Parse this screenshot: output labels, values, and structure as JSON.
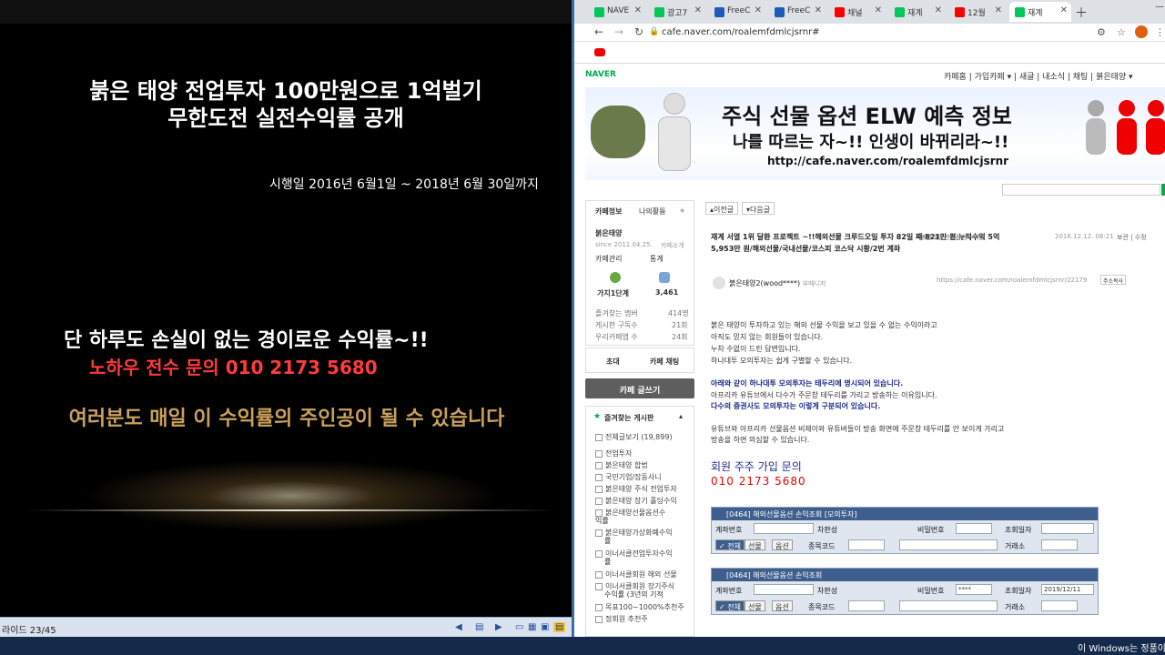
{
  "slide": {
    "title_line1": "붉은 태양 전업투자  100만원으로 1억벌기",
    "title_line2": "무한도전 실전수익률  공개",
    "date_line": "시행일 2016년 6월1일 ~ 2018년 6월 30일까지",
    "line1": "단 하루도 손실이 없는 경이로운 수익률~!!",
    "line2": "노하우 전수 문의 010 2173 5680",
    "line3": "여러분도 매일 이 수익률의 주인공이 될 수 있습니다"
  },
  "slidebar": {
    "label": "라이드 23/45"
  },
  "taskbar": {
    "windows_note": "이 Windows는 정품이 아닙니다"
  },
  "browser": {
    "tabs": [
      {
        "label": "NAVE",
        "icon_color": "#03c75a"
      },
      {
        "label": "광고7",
        "icon_color": "#03c75a"
      },
      {
        "label": "FreeC",
        "icon_color": "#1e5bb8"
      },
      {
        "label": "FreeC",
        "icon_color": "#1e5bb8"
      },
      {
        "label": "채널",
        "icon_color": "#ff0000"
      },
      {
        "label": "재계",
        "icon_color": "#03c75a"
      },
      {
        "label": "12월",
        "icon_color": "#ff0000"
      },
      {
        "label": "재계",
        "icon_color": "#03c75a"
      }
    ],
    "url": "cafe.naver.com/roalemfdmlcjsrnr#"
  },
  "cafe": {
    "logo": "NAVER",
    "menu": "카페홈  |  가입카페 ▾  |  새글  |  내소식  |  채팅  |  붉은태양 ▾",
    "banner_line1": "주식 선물 옵션 ELW 예측 정보",
    "banner_line2": "나를 따르는 자~!! 인생이 바뀌리라~!!",
    "banner_line3": "http://cafe.naver.com/roalemfdmlcjsrnr",
    "side": {
      "tab_info": "카페정보",
      "tab_activity": "나의활동",
      "cafe_name": "붉은태양",
      "since": "since 2011.04.25.",
      "invite": "카페소개",
      "manage": "카페관리",
      "stats": "통계",
      "level": "가지1단계",
      "members": "3,461",
      "fav_members_label": "즐겨찾는 멤버",
      "fav_members_value": "414명",
      "subscribers_label": "게시판 구독수",
      "subscribers_value": "21회",
      "cafe_apps_label": "우리카페앱 수",
      "cafe_apps_value": "24회",
      "invite_btn": "초대",
      "chat_btn": "카페 채팅",
      "write_btn": "카페 글쓰기",
      "fav_board_title": "즐겨찾는 게시판",
      "all_posts": "전체글보기 (19,899)",
      "boards": [
        "전업투자",
        "붉은태양 합법",
        "국민기업/잡동사니",
        "붉은태양 주식 전업투자",
        "붉은태양 장기 홀딩수익",
        "붉은태양선물옵션수",
        "익률",
        "붉은태양가상화폐수익",
        "률",
        "이너서클전업투자수익",
        "률",
        "이너서클회원 해외 선물",
        "이너서클회원 장기주식",
        "수익률 (3년의 기적",
        "목표100~1000%추천주",
        "정회원 추천주"
      ]
    },
    "article": {
      "prev_btn": "▴이전글",
      "next_btn": "▾다음글",
      "title": "재계 서열 1위 달환 프로젝트 ~!!해외선물 크루드오일  투자 82일 째 821만 원 누적수익 5억 5,953만 원/해외선물/국내선물/코스피 코스닥 시황/2번 계좌",
      "board": "붉은태양선물옵션수익률",
      "date": "2016.12.12. 06:21",
      "date_actions": "보관  |  수정",
      "author": "붉은태양2(wood****)",
      "author_tag": "부매니저",
      "permalink": "https://cafe.naver.com/roalemfdmlcjsrnr/22179",
      "copy_btn": "주소복사",
      "paras": [
        "붉은 태양이 투자하고 있는 해외 선물 수익을 보고 있을 수 없는 수익이라고",
        "아직도 믿지 않는 회원들이 있습니다.",
        "누차 수없이 드린 답변입니다.",
        "하나대투 모의투자는 쉽게 구별할 수 있습니다."
      ],
      "blue1": "아래와 같이 하나대투 모의투자는 테두리에 명시되어 있습니다.",
      "para5": "아프리카 유튜브에서 다수가 주문창 테두리를 가리고 방송하는 이유입니다.",
      "blue2": "다수의 증권사도 모의투자는 이렇게 구분되어 있습니다.",
      "para6": "유튜브와 아프리카 선물옵션 비제이와 유튜버들이 방송 화면에 주문창 테두리를 안 보이게 가리고",
      "para7": "방송을 하면 의심할 수 있습니다.",
      "join_title": "회원 주주 가입 문의",
      "join_phone": "010  2173  5680",
      "panel1_title": "[0464] 해외선물옵션 손익조회 [모의투자]",
      "panel2_title": "[0464] 해외선물옵션 손익조회",
      "lbl_account": "계좌번호",
      "lbl_name": "차판성",
      "lbl_password": "비밀번호",
      "lbl_date": "조회일자",
      "lbl_all": "전체",
      "lbl_futures": "선물",
      "lbl_options": "옵션",
      "lbl_code": "종목코드",
      "lbl_exchange": "거래소",
      "password_value": "****",
      "date_value": "2019/12/11"
    }
  }
}
